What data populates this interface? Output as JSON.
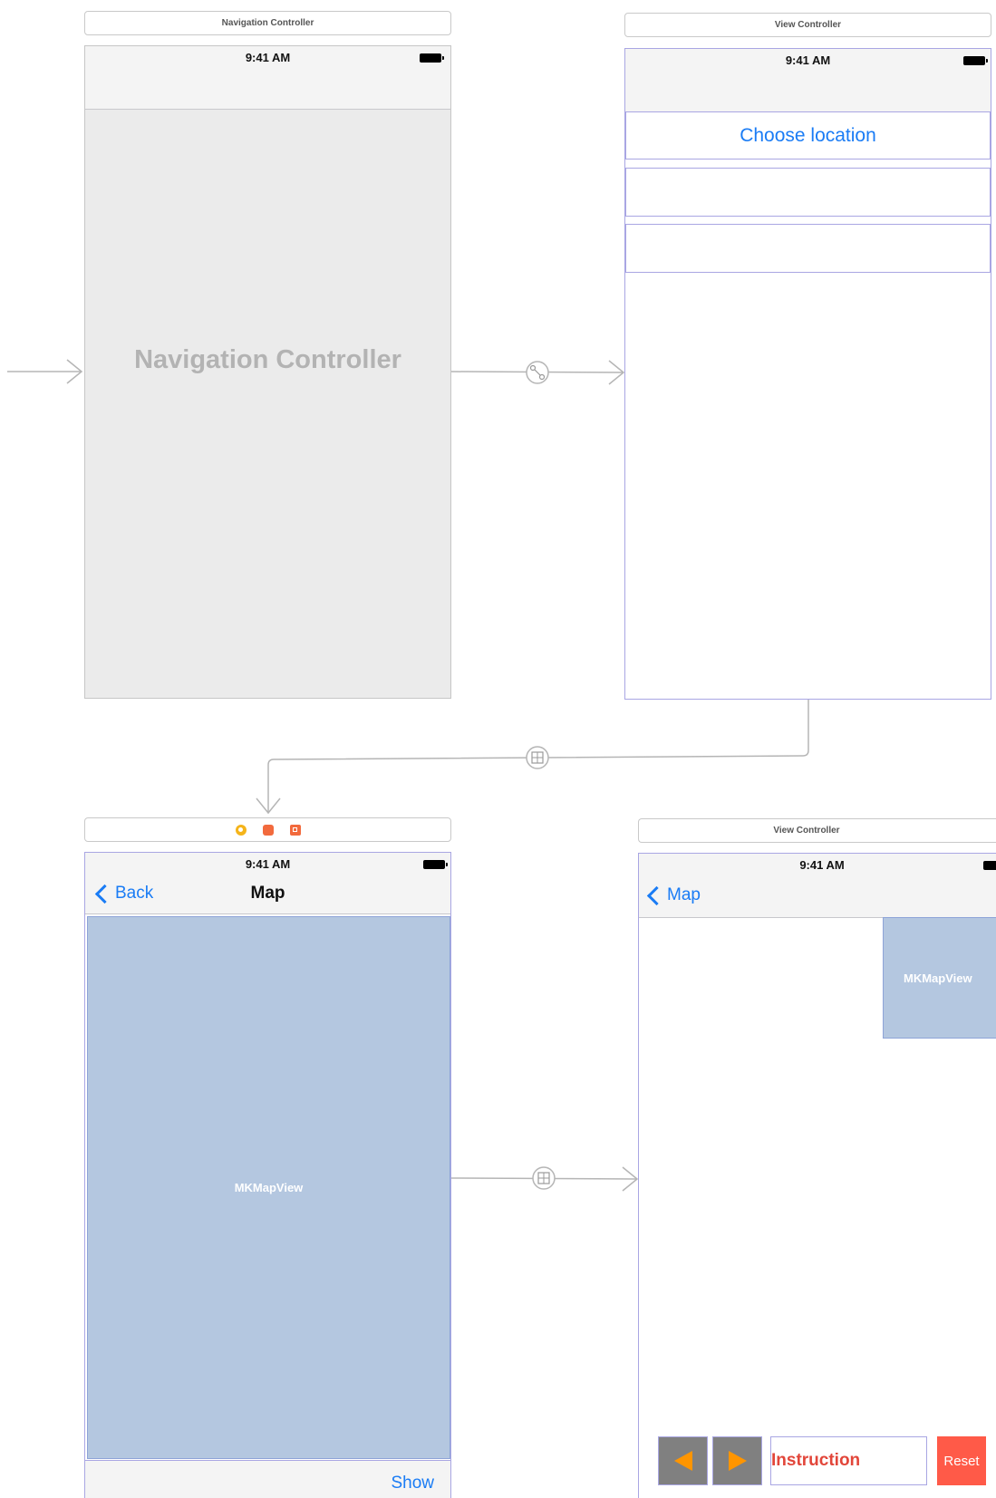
{
  "scenes": {
    "navigation_controller": {
      "title": "Navigation Controller",
      "status_time": "9:41 AM",
      "placeholder": "Navigation Controller"
    },
    "view_controller_1": {
      "title": "View Controller",
      "status_time": "9:41 AM",
      "choose_location_label": "Choose location"
    },
    "map_scene": {
      "status_time": "9:41 AM",
      "back_label": "Back",
      "nav_title": "Map",
      "map_view_label": "MKMapView",
      "show_label": "Show"
    },
    "view_controller_2": {
      "title": "View Controller",
      "status_time": "9:41 AM",
      "back_label": "Map",
      "map_view_label": "MKMapView",
      "instruction_label": "Instruction",
      "reset_label": "Reset"
    }
  },
  "icons": {
    "segue_relationship": "segue-link-icon",
    "segue_show": "segue-show-icon",
    "scene_dock": [
      "view-controller-icon",
      "first-responder-icon",
      "exit-icon"
    ],
    "prev": "left-triangle-icon",
    "next": "right-triangle-icon"
  },
  "colors": {
    "ios_blue": "#1a7cf5",
    "map_fill": "#b4c7e0",
    "selection_border": "#a9a6e3",
    "reset_red": "#ff5a48",
    "instruction_red": "#e2463a",
    "arrow_orange": "#ff9500",
    "arrow_button_gray": "#808080"
  }
}
